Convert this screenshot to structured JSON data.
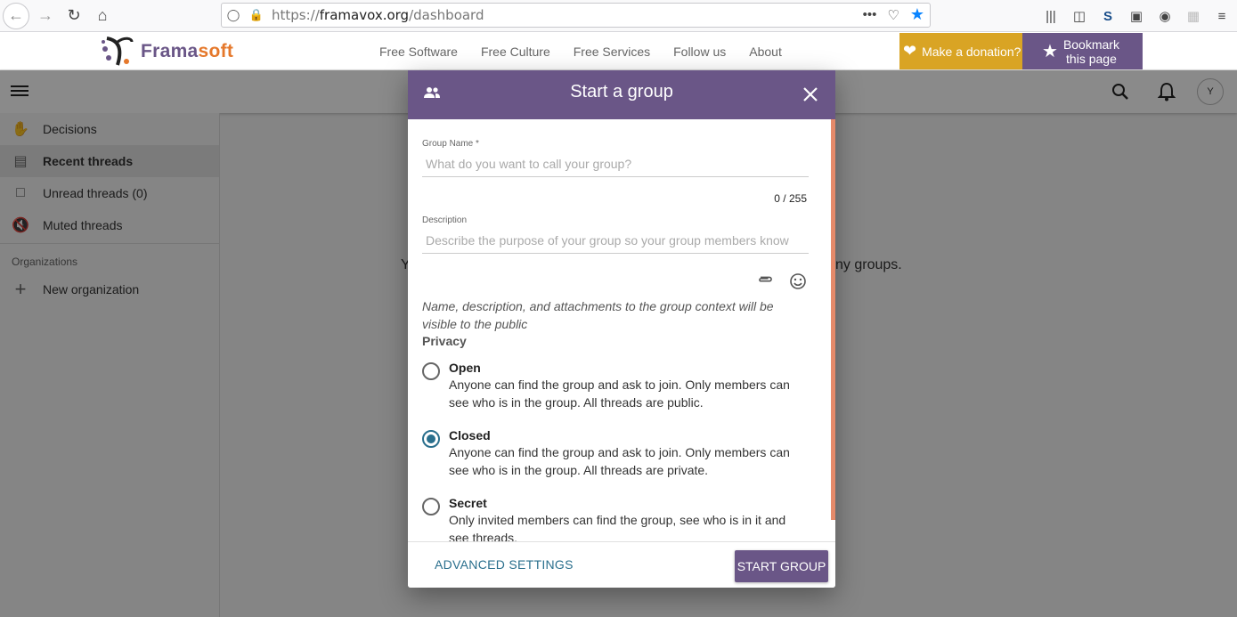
{
  "browser": {
    "url_prefix": "https://",
    "url_host": "framavox.org",
    "url_path": "/dashboard"
  },
  "site": {
    "logo_a": "Frama",
    "logo_b": "soft",
    "nav": [
      "Free Software",
      "Free Culture",
      "Free Services",
      "Follow us",
      "About"
    ],
    "donate": "Make a donation?",
    "bookmark_1": "Bookmark",
    "bookmark_2": "this page"
  },
  "toolbar": {
    "avatar": "Y"
  },
  "sidebar": {
    "items": [
      {
        "label": "Decisions"
      },
      {
        "label": "Recent threads"
      },
      {
        "label": "Unread threads (0)"
      },
      {
        "label": "Muted threads"
      }
    ],
    "section": "Organizations",
    "new_org": "New organization"
  },
  "main": {
    "msg_left": "Y",
    "msg_right": "ny groups."
  },
  "dialog": {
    "title": "Start a group",
    "name_label": "Group Name *",
    "name_placeholder": "What do you want to call your group?",
    "counter": "0 / 255",
    "desc_label": "Description",
    "desc_placeholder": "Describe the purpose of your group so your group members know",
    "note": "Name, description, and attachments to the group context will be visible to the public",
    "privacy": "Privacy",
    "options": [
      {
        "name": "Open",
        "desc": "Anyone can find the group and ask to join. Only members can see who is in the group. All threads are public."
      },
      {
        "name": "Closed",
        "desc": "Anyone can find the group and ask to join. Only members can see who is in the group. All threads are private."
      },
      {
        "name": "Secret",
        "desc": "Only invited members can find the group, see who is in it and see threads."
      }
    ],
    "advanced": "ADVANCED SETTINGS",
    "start": "START GROUP"
  },
  "colors": {
    "brand": "#6a5687",
    "accent": "#e5782b",
    "donate": "#d9a424",
    "link": "#2a6f8d"
  }
}
